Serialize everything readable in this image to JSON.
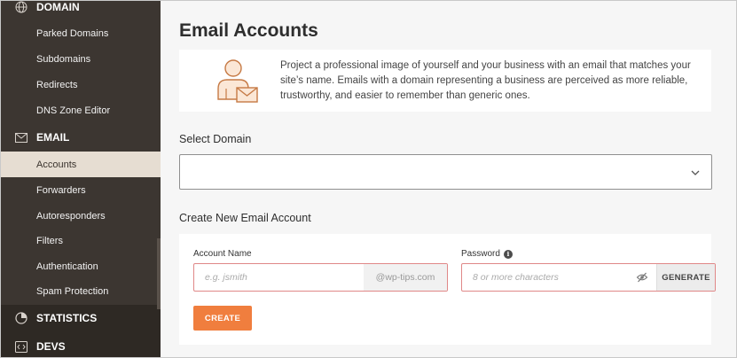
{
  "sidebar": {
    "sections": [
      {
        "label": "DOMAIN",
        "icon": "globe-icon"
      },
      {
        "label": "EMAIL",
        "icon": "envelope-icon"
      },
      {
        "label": "STATISTICS",
        "icon": "pie-chart-icon"
      },
      {
        "label": "DEVS",
        "icon": "code-icon"
      }
    ],
    "domain_items": [
      "Parked Domains",
      "Subdomains",
      "Redirects",
      "DNS Zone Editor"
    ],
    "email_items": [
      "Accounts",
      "Forwarders",
      "Autoresponders",
      "Filters",
      "Authentication",
      "Spam Protection"
    ],
    "active_item": "Accounts"
  },
  "main": {
    "title": "Email Accounts",
    "intro_text": "Project a professional image of yourself and your business with an email that matches your site’s name. Emails with a domain representing a business are perceived as more reliable, trustworthy, and easier to remember than generic ones.",
    "select_domain_label": "Select Domain",
    "select_domain_value": "",
    "create_label": "Create New Email Account",
    "account_name_label": "Account Name",
    "account_name_placeholder": "e.g. jsmith",
    "domain_suffix": "@wp-tips.com",
    "password_label": "Password",
    "password_placeholder": "8 or more characters",
    "generate_label": "GENERATE",
    "create_button": "CREATE"
  },
  "colors": {
    "sidebar_bg": "#3c3631",
    "active_item_bg": "#e6ddd2",
    "accent_orange": "#f07e3e",
    "error_border": "#e08888"
  }
}
